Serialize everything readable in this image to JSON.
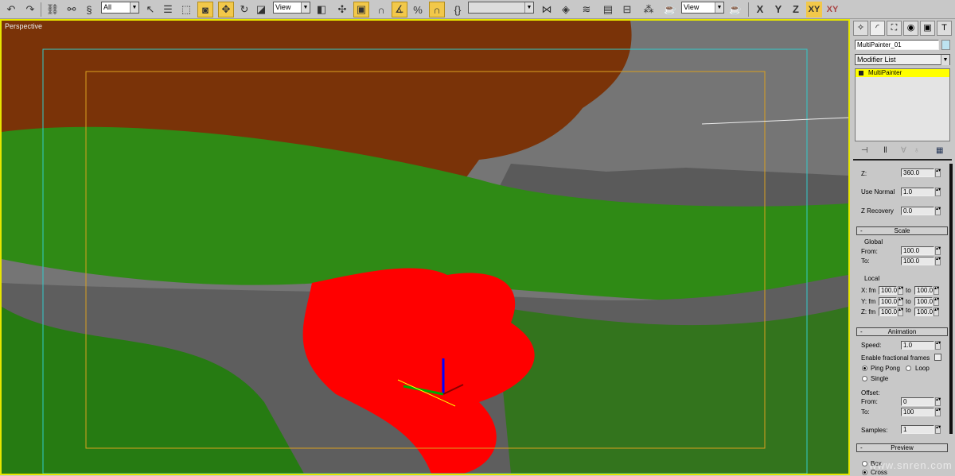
{
  "toolbar": {
    "selection_filter": "All",
    "ref_coord": "View",
    "named_sel": "",
    "render_view": "View",
    "axes": [
      "X",
      "Y",
      "Z",
      "XY",
      "XY"
    ]
  },
  "viewport": {
    "label": "Perspective"
  },
  "panel": {
    "object_name": "MultiPainter_01",
    "modifier_list": "Modifier List",
    "stack_item": "MultiPainter",
    "rotation": {
      "z_label": "Z:",
      "z_value": "360.0",
      "use_normal_label": "Use Normal",
      "use_normal": "1.0",
      "z_recovery_label": "Z Recovery",
      "z_recovery": "0.0"
    },
    "scale": {
      "title": "Scale",
      "collapse": "-",
      "global": "Global",
      "from_label": "From:",
      "from": "100.0",
      "to_label": "To:",
      "to": "100.0",
      "local": "Local",
      "rows": [
        {
          "label": "X: fm",
          "fm": "100.0",
          "to_label": "to",
          "to": "100.0"
        },
        {
          "label": "Y: fm",
          "fm": "100.0",
          "to_label": "to",
          "to": "100.0"
        },
        {
          "label": "Z: fm",
          "fm": "100.0",
          "to_label": "to",
          "to": "100.0"
        }
      ]
    },
    "animation": {
      "title": "Animation",
      "collapse": "-",
      "speed_label": "Speed:",
      "speed": "1.0",
      "fractional_label": "Enable fractional frames",
      "pingpong": "Ping Pong",
      "loop": "Loop",
      "single": "Single",
      "offset": "Offset:",
      "from_label": "From:",
      "from": "0",
      "to_label": "To:",
      "to": "100",
      "samples_label": "Samples:",
      "samples": "1"
    },
    "preview": {
      "title": "Preview",
      "collapse": "-",
      "box": "Box",
      "cross": "Cross"
    }
  },
  "watermark": "www.snren.com",
  "colors": {
    "accent": "#f2c84a",
    "selection": "#ff0000",
    "stack_highlight": "#ffff00"
  }
}
